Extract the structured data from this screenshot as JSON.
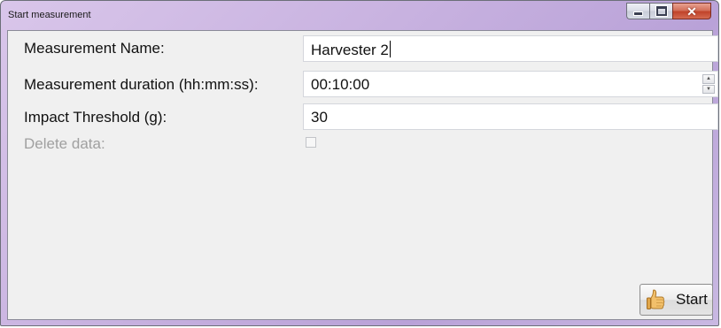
{
  "window": {
    "title": "Start measurement"
  },
  "form": {
    "name_label": "Measurement Name:",
    "name_value": "Harvester 2",
    "duration_label": "Measurement duration (hh:mm:ss):",
    "duration_value": "00:10:00",
    "threshold_label": "Impact Threshold (g):",
    "threshold_value": "30",
    "delete_label": "Delete data:",
    "delete_checked": false
  },
  "actions": {
    "start_label": "Start",
    "start_icon": "thumbs-up-icon"
  },
  "colors": {
    "titlebar_accent": "#c8b2e0",
    "close_button": "#c0432a",
    "client_background": "#f0f0f0"
  }
}
